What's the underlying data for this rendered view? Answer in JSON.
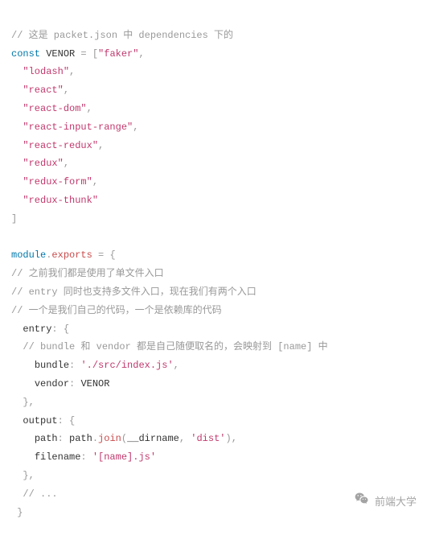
{
  "comments": {
    "top": "// 这是 packet.json 中 dependencies 下的",
    "c1": "// 之前我们都是使用了单文件入口",
    "c2": "// entry 同时也支持多文件入口，现在我们有两个入口",
    "c3": "// 一个是我们自己的代码，一个是依赖库的代码",
    "c4": "// bundle 和 vendor 都是自己随便取名的，会映射到 [name] 中",
    "c5": "// ..."
  },
  "keywords": {
    "const": "const",
    "module": "module"
  },
  "idents": {
    "venor": "VENOR",
    "exports": "exports",
    "entry": "entry",
    "bundle": "bundle",
    "vendor": "vendor",
    "output": "output",
    "path": "path",
    "join": "join",
    "dirname": "__dirname",
    "filename": "filename"
  },
  "punct": {
    "eq": " = ",
    "lbracket": "[",
    "rbracket": "]",
    "comma": ",",
    "lbrace": "{",
    "rbrace": "}",
    "colon": ": ",
    "dot": ".",
    "lparen": "(",
    "rparen": ")"
  },
  "strings": {
    "faker": "\"faker\"",
    "lodash": "\"lodash\"",
    "react": "\"react\"",
    "reactDom": "\"react-dom\"",
    "reactInputRange": "\"react-input-range\"",
    "reactRedux": "\"react-redux\"",
    "redux": "\"redux\"",
    "reduxForm": "\"redux-form\"",
    "reduxThunk": "\"redux-thunk\"",
    "srcIndex": "'./src/index.js'",
    "dist": "'dist'",
    "nameJs": "'[name].js'"
  },
  "watermark": {
    "text": "前端大学"
  }
}
